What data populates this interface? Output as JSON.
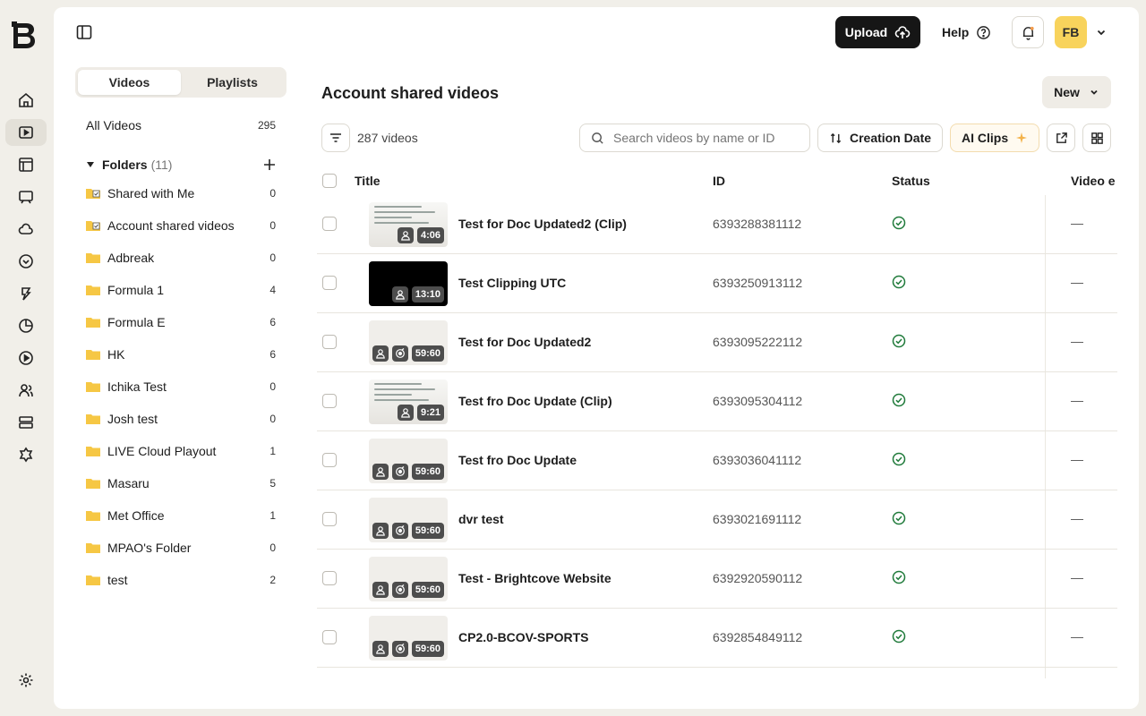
{
  "rail": {
    "logo": "B",
    "icons": [
      "home-icon",
      "video-icon",
      "table-icon",
      "player-icon",
      "cloud-icon",
      "engage-icon",
      "brain-icon",
      "analytics-icon",
      "play-circle-icon",
      "users-icon",
      "storage-icon",
      "plugin-icon",
      "settings-icon"
    ]
  },
  "header": {
    "upload_label": "Upload",
    "help_label": "Help",
    "avatar_initials": "FB"
  },
  "sidebar": {
    "tabs": [
      {
        "label": "Videos",
        "active": true
      },
      {
        "label": "Playlists",
        "active": false
      }
    ],
    "all_videos": {
      "label": "All Videos",
      "count": "295"
    },
    "folders_label": "Folders",
    "folders_count": "(11)",
    "folders": [
      {
        "label": "Shared with Me",
        "count": "0",
        "special": true
      },
      {
        "label": "Account shared videos",
        "count": "0",
        "special": true
      },
      {
        "label": "Adbreak",
        "count": "0"
      },
      {
        "label": "Formula 1",
        "count": "4"
      },
      {
        "label": "Formula E",
        "count": "6"
      },
      {
        "label": "HK",
        "count": "6"
      },
      {
        "label": "Ichika Test",
        "count": "0"
      },
      {
        "label": "Josh test",
        "count": "0"
      },
      {
        "label": "LIVE Cloud Playout",
        "count": "1"
      },
      {
        "label": "Masaru",
        "count": "5"
      },
      {
        "label": "Met Office",
        "count": "1"
      },
      {
        "label": "MPAO's Folder",
        "count": "0"
      },
      {
        "label": "test",
        "count": "2"
      }
    ]
  },
  "main": {
    "title": "Account shared videos",
    "new_label": "New",
    "video_count": "287 videos",
    "search_placeholder": "Search videos by name or ID",
    "sort_label": "Creation Date",
    "ai_clips_label": "AI Clips",
    "columns": [
      "Title",
      "ID",
      "Status",
      "Video e"
    ],
    "rows": [
      {
        "title": "Test for Doc Updated2 (Clip)",
        "id": "6393288381112",
        "status": "active",
        "edited": "—",
        "duration": "4:06",
        "thumb": "slide",
        "badges": [
          "user"
        ]
      },
      {
        "title": "Test Clipping UTC",
        "id": "6393250913112",
        "status": "active",
        "edited": "—",
        "duration": "13:10",
        "thumb": "black",
        "badges": [
          "user"
        ]
      },
      {
        "title": "Test for Doc Updated2",
        "id": "6393095222112",
        "status": "active",
        "edited": "—",
        "duration": "59:60",
        "thumb": "light",
        "badges": [
          "user",
          "live"
        ]
      },
      {
        "title": "Test fro Doc Update (Clip)",
        "id": "6393095304112",
        "status": "active",
        "edited": "—",
        "duration": "9:21",
        "thumb": "slide",
        "badges": [
          "user"
        ]
      },
      {
        "title": "Test fro Doc Update",
        "id": "6393036041112",
        "status": "active",
        "edited": "—",
        "duration": "59:60",
        "thumb": "light",
        "badges": [
          "user",
          "live"
        ]
      },
      {
        "title": "dvr test",
        "id": "6393021691112",
        "status": "active",
        "edited": "—",
        "duration": "59:60",
        "thumb": "light",
        "badges": [
          "user",
          "live"
        ]
      },
      {
        "title": "Test - Brightcove Website",
        "id": "6392920590112",
        "status": "active",
        "edited": "—",
        "duration": "59:60",
        "thumb": "light",
        "badges": [
          "user",
          "live"
        ]
      },
      {
        "title": "CP2.0-BCOV-SPORTS",
        "id": "6392854849112",
        "status": "active",
        "edited": "—",
        "duration": "59:60",
        "thumb": "light",
        "badges": [
          "user",
          "live"
        ]
      }
    ]
  },
  "colors": {
    "accent_dark": "#161616",
    "status_green": "#1f7a3a",
    "folder_yellow": "#f6c744",
    "avatar_bg": "#f8d35c",
    "ai_border": "#f3dcae"
  }
}
